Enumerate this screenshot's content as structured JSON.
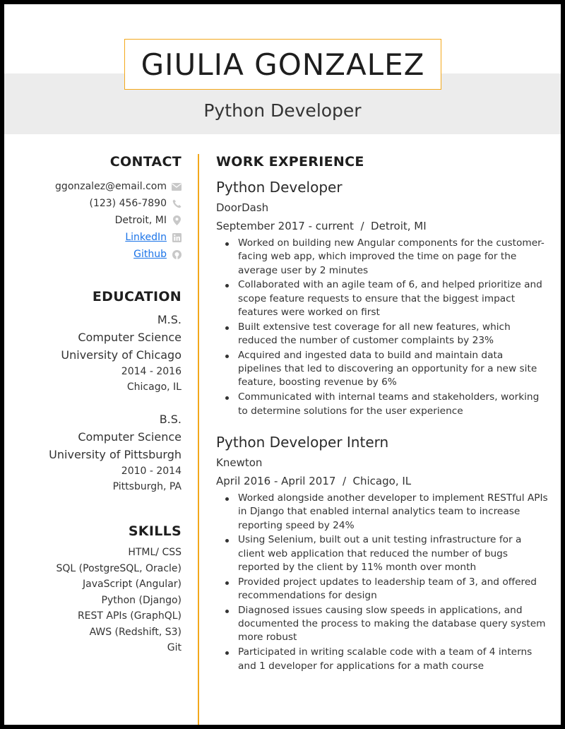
{
  "header": {
    "name": "GIULIA GONZALEZ",
    "title": "Python Developer"
  },
  "contact": {
    "heading": "CONTACT",
    "email": "ggonzalez@email.com",
    "phone": "(123) 456-7890",
    "location": "Detroit, MI",
    "linkedin": "LinkedIn",
    "github": "Github"
  },
  "education": {
    "heading": "EDUCATION",
    "entries": [
      {
        "degree": "M.S.",
        "field": "Computer Science",
        "school": "University of Chicago",
        "years": "2014 - 2016",
        "location": "Chicago, IL"
      },
      {
        "degree": "B.S.",
        "field": "Computer Science",
        "school": "University of Pittsburgh",
        "years": "2010 - 2014",
        "location": "Pittsburgh, PA"
      }
    ]
  },
  "skills": {
    "heading": "SKILLS",
    "items": [
      "HTML/ CSS",
      "SQL (PostgreSQL, Oracle)",
      "JavaScript (Angular)",
      "Python (Django)",
      "REST APIs (GraphQL)",
      "AWS (Redshift, S3)",
      "Git"
    ]
  },
  "experience": {
    "heading": "WORK EXPERIENCE",
    "jobs": [
      {
        "title": "Python Developer",
        "company": "DoorDash",
        "dates": "September 2017 - current  /  Detroit, MI",
        "bullets": [
          "Worked on building new Angular components for the customer-facing web app, which improved the time on page for the average user by 2 minutes",
          "Collaborated with an agile team of 6, and helped prioritize and scope feature requests to ensure that the biggest impact features were worked on first",
          "Built extensive test coverage for all new features, which reduced the number of customer complaints by 23%",
          "Acquired and ingested data to build and maintain data pipelines that led to discovering an opportunity for a new site feature, boosting revenue by 6%",
          "Communicated with internal teams and stakeholders, working to determine solutions for the user experience"
        ]
      },
      {
        "title": "Python Developer Intern",
        "company": "Knewton",
        "dates": "April 2016 - April 2017  /  Chicago, IL",
        "bullets": [
          "Worked alongside another developer to implement RESTful APIs in Django that enabled internal analytics team to increase reporting speed by 24%",
          "Using Selenium, built out a unit testing infrastructure for a client web application that reduced the number of bugs reported by the client by 11% month over month",
          "Provided project updates to leadership team of 3, and offered recommendations for design",
          "Diagnosed issues causing slow speeds in applications, and documented the process to making the database query system more robust",
          "Participated in writing scalable code with a team of 4 interns and 1 developer for applications for a math course"
        ]
      }
    ]
  },
  "colors": {
    "accent": "#f3a81b",
    "band": "#ececec",
    "link": "#1a73e8",
    "icon": "#c8c8c8"
  }
}
